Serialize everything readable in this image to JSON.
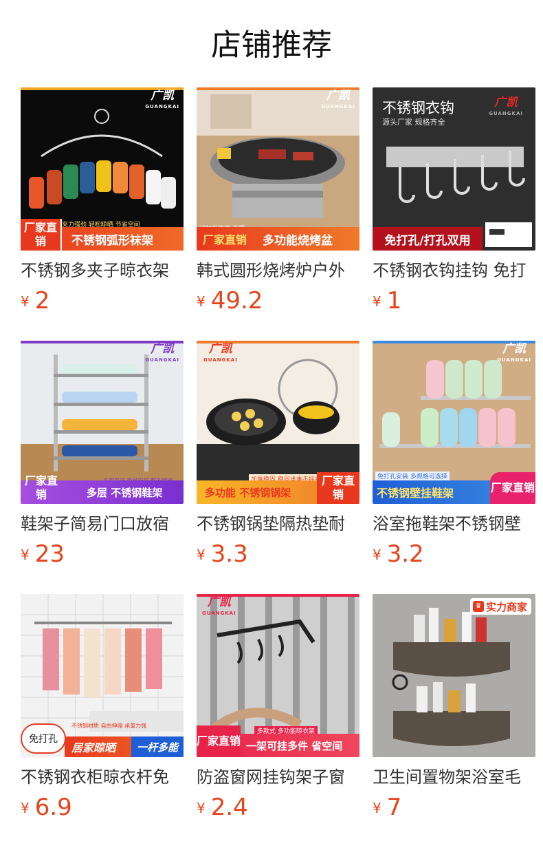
{
  "page": {
    "title": "店铺推荐"
  },
  "brand": {
    "cn": "广凯",
    "en": "GUANGKAI"
  },
  "currency": "¥",
  "colors": {
    "price": "#e8431a",
    "title": "#111111",
    "text": "#333333"
  },
  "products": [
    {
      "name": "不锈钢多夹子晾衣架",
      "price": "2",
      "badge": "厂家直销",
      "banner": "不锈钢弧形袜架",
      "subbanner": "夹力强劲 轻松晾晒 节省空间"
    },
    {
      "name": "韩式圆形烧烤炉户外",
      "price": "49.2",
      "badge": "厂家直销",
      "banner": "多功能烧烤盆",
      "subbanner": "可加炭烧烤 无烟"
    },
    {
      "name": "不锈钢衣钩挂钩 免打",
      "price": "1",
      "headline": "不锈钢衣钩",
      "tagline": "源头厂家 规格齐全",
      "banner": "免打孔/打孔双用"
    },
    {
      "name": "鞋架子简易门口放宿",
      "price": "23",
      "badge": "厂家直销",
      "banner": "多层 不锈钢鞋架",
      "subbanner": "多款可选 简易安装 整齐摆放"
    },
    {
      "name": "不锈钢锅垫隔热垫耐",
      "price": "3.3",
      "badge": "厂家直销",
      "banner": "多功能 不锈钢锅架",
      "subbanner": "加厚稳固 稳固承重不摇晃"
    },
    {
      "name": "浴室拖鞋架不锈钢壁",
      "price": "3.2",
      "badge": "厂家直销",
      "banner": "不锈钢壁挂鞋架",
      "subbanner": "免打孔安装 多规格可选择"
    },
    {
      "name": "不锈钢衣柜晾衣杆免",
      "price": "6.9",
      "badge": "免打孔",
      "banner": "居家晾晒",
      "banner2": "一杆多能",
      "subbanner": "不锈钢材质 自由伸缩 承重力强"
    },
    {
      "name": "防盗窗网挂钩架子窗",
      "price": "2.4",
      "badge": "厂家直销",
      "banner": "一架可挂多件 省空间",
      "subbanner": "多款式 多功能晾衣架"
    },
    {
      "name": "卫生间置物架浴室毛",
      "price": "7",
      "seal": "实力商家"
    }
  ]
}
